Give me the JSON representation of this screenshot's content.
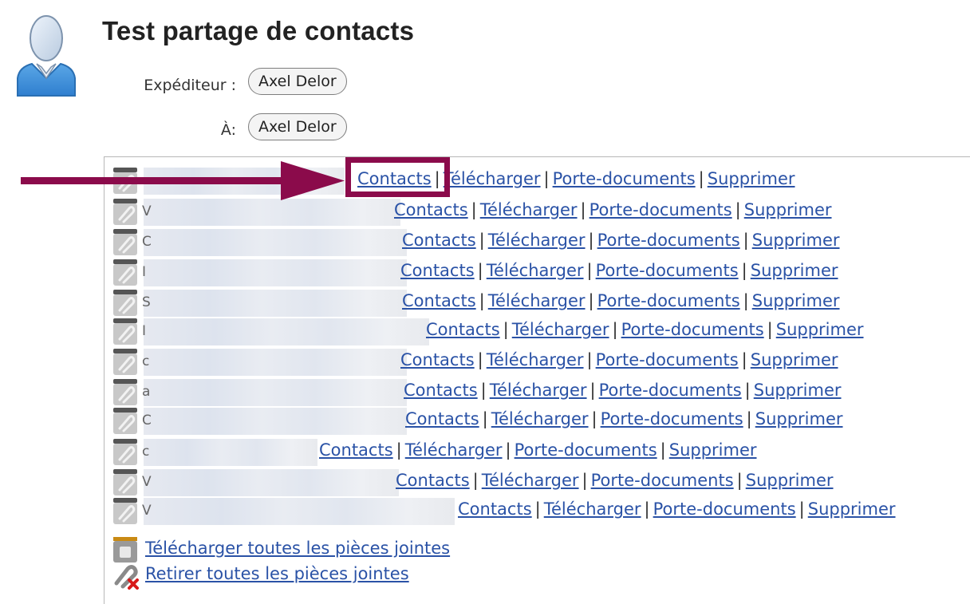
{
  "message": {
    "subject": "Test partage de contacts",
    "from_label": "Expéditeur :",
    "from_value": "Axel Delor",
    "to_label": "À:",
    "to_value": "Axel Delor"
  },
  "attachments": {
    "rows": [
      {
        "letter": "",
        "links": {
          "contacts": "Contacts",
          "download": "Télécharger",
          "briefcase": "Porte-documents",
          "delete": "Supprimer"
        }
      },
      {
        "letter": "V",
        "links": {
          "contacts": "Contacts",
          "download": "Télécharger",
          "briefcase": "Porte-documents",
          "delete": "Supprimer"
        }
      },
      {
        "letter": "C",
        "links": {
          "contacts": "Contacts",
          "download": "Télécharger",
          "briefcase": "Porte-documents",
          "delete": "Supprimer"
        }
      },
      {
        "letter": "I",
        "links": {
          "contacts": "Contacts",
          "download": "Télécharger",
          "briefcase": "Porte-documents",
          "delete": "Supprimer"
        }
      },
      {
        "letter": "S",
        "links": {
          "contacts": "Contacts",
          "download": "Télécharger",
          "briefcase": "Porte-documents",
          "delete": "Supprimer"
        }
      },
      {
        "letter": "I",
        "links": {
          "contacts": "Contacts",
          "download": "Télécharger",
          "briefcase": "Porte-documents",
          "delete": "Supprimer"
        }
      },
      {
        "letter": "c",
        "links": {
          "contacts": "Contacts",
          "download": "Télécharger",
          "briefcase": "Porte-documents",
          "delete": "Supprimer"
        }
      },
      {
        "letter": "a",
        "links": {
          "contacts": "Contacts",
          "download": "Télécharger",
          "briefcase": "Porte-documents",
          "delete": "Supprimer"
        }
      },
      {
        "letter": "C",
        "links": {
          "contacts": "Contacts",
          "download": "Télécharger",
          "briefcase": "Porte-documents",
          "delete": "Supprimer"
        }
      },
      {
        "letter": "c",
        "links": {
          "contacts": "Contacts",
          "download": "Télécharger",
          "briefcase": "Porte-documents",
          "delete": "Supprimer"
        }
      },
      {
        "letter": "V",
        "links": {
          "contacts": "Contacts",
          "download": "Télécharger",
          "briefcase": "Porte-documents",
          "delete": "Supprimer"
        }
      },
      {
        "letter": "V",
        "links": {
          "contacts": "Contacts",
          "download": "Télécharger",
          "briefcase": "Porte-documents",
          "delete": "Supprimer"
        }
      }
    ],
    "download_all": "Télécharger toutes les pièces jointes",
    "remove_all": "Retirer toutes les pièces jointes"
  },
  "icons": {
    "avatar": "user-avatar-icon",
    "attachment": "paperclip-icon",
    "download_all": "download-all-icon",
    "remove_all": "remove-attachments-icon"
  },
  "colors": {
    "link": "#2a52a6",
    "annotation": "#8b0b4b",
    "avatar": "#3d8fd6"
  }
}
